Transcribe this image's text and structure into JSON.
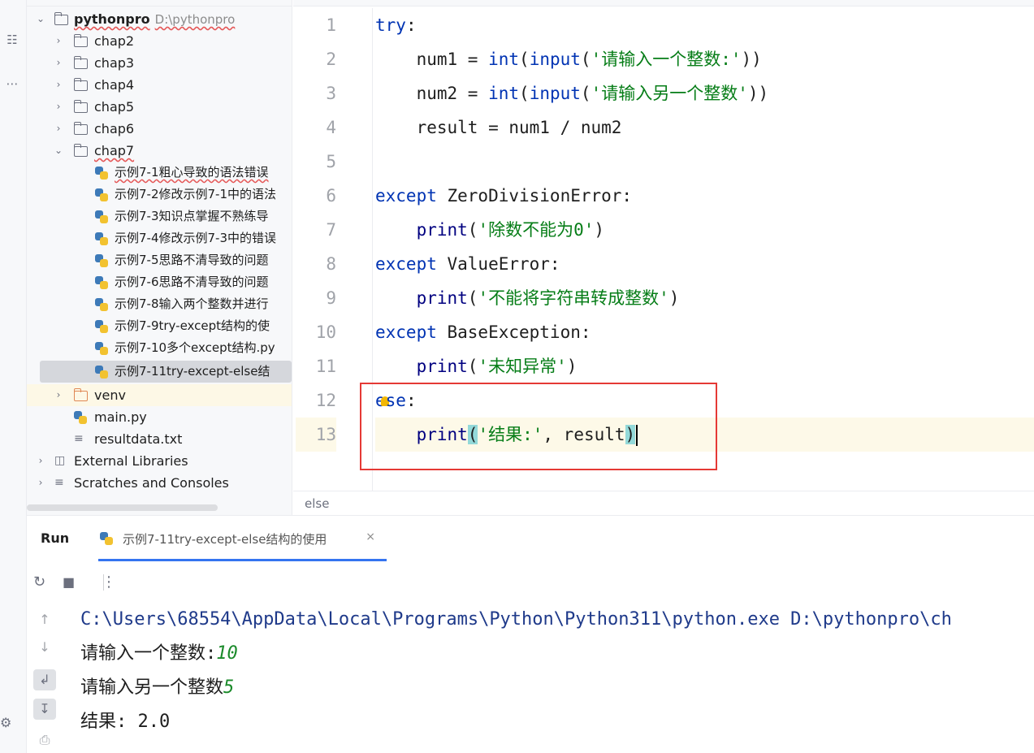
{
  "project_tree": {
    "root": {
      "name": "pythonpro",
      "path": "D:\\pythonpro"
    },
    "folders": [
      "chap2",
      "chap3",
      "chap4",
      "chap5",
      "chap6"
    ],
    "open_folder": "chap7",
    "files": [
      "示例7-1粗心导致的语法错误",
      "示例7-2修改示例7-1中的语法",
      "示例7-3知识点掌握不熟练导",
      "示例7-4修改示例7-3中的错误",
      "示例7-5思路不清导致的问题",
      "示例7-6思路不清导致的问题",
      "示例7-8输入两个整数并进行",
      "示例7-9try-except结构的使",
      "示例7-10多个except结构.py",
      "示例7-11try-except-else结"
    ],
    "venv": "venv",
    "main_file": "main.py",
    "txt_file": "resultdata.txt",
    "external_libraries": "External Libraries",
    "scratches": "Scratches and Consoles"
  },
  "editor": {
    "line_numbers": [
      "1",
      "2",
      "3",
      "4",
      "5",
      "6",
      "7",
      "8",
      "9",
      "10",
      "11",
      "12",
      "13"
    ],
    "lines": {
      "l1_kw": "try",
      "l1_colon": ":",
      "l2_var": "num1 = ",
      "l2_int": "int",
      "l2_open": "(",
      "l2_input": "input",
      "l2_paren": "(",
      "l2_str": "'请输入一个整数:'",
      "l2_close": "))",
      "l3_var": "num2 = ",
      "l3_int": "int",
      "l3_open": "(",
      "l3_input": "input",
      "l3_paren": "(",
      "l3_str": "'请输入另一个整数'",
      "l3_close": "))",
      "l4": "result = num1 / num2",
      "l6_kw": "except",
      "l6_rest": " ZeroDivisionError:",
      "l7_print": "print",
      "l7_open": "(",
      "l7_str": "'除数不能为0'",
      "l7_close": ")",
      "l8_kw": "except",
      "l8_rest": " ValueError:",
      "l9_print": "print",
      "l9_open": "(",
      "l9_str": "'不能将字符串转成整数'",
      "l9_close": ")",
      "l10_kw": "except",
      "l10_rest": " BaseException:",
      "l11_print": "print",
      "l11_open": "(",
      "l11_str": "'未知异常'",
      "l11_close": ")",
      "l12_kw_a": "e",
      "l12_kw_b": "se",
      "l12_colon": ":",
      "l13_print": "print",
      "l13_open": "(",
      "l13_str": "'结果:'",
      "l13_rest": ", result",
      "l13_close": ")"
    },
    "breadcrumb": "else"
  },
  "run": {
    "title": "Run",
    "tab": "示例7-11try-except-else结构的使用",
    "close": "×",
    "console": {
      "command": "C:\\Users\\68554\\AppData\\Local\\Programs\\Python\\Python311\\python.exe D:\\pythonpro\\ch",
      "prompt1": "请输入一个整数:",
      "input1": "10",
      "prompt2": "请输入另一个整数",
      "input2": "5",
      "result": "结果: 2.0"
    }
  },
  "colors": {
    "keyword": "#0033b3",
    "string": "#067d17",
    "builtin": "#000080",
    "highlight_box": "#e53935",
    "brace_match": "#93d9d9",
    "console_input": "#1a8a2a"
  }
}
